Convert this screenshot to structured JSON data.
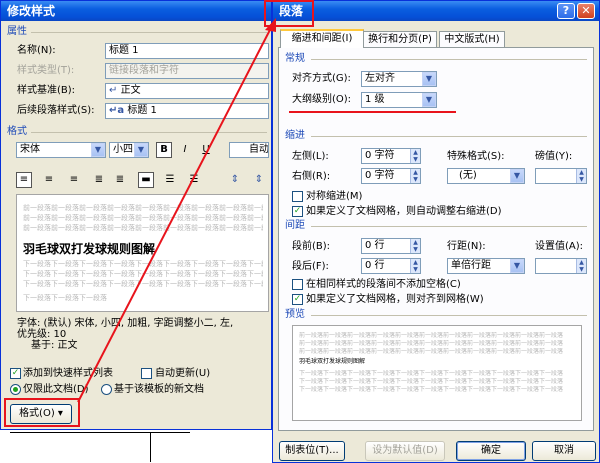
{
  "left_dialog": {
    "title": "修改样式",
    "properties_section": "属性",
    "name_label": "名称(N):",
    "name_value": "标题 1",
    "style_type_label": "样式类型(T):",
    "style_type_value": "链接段落和字符",
    "based_on_label": "样式基准(B):",
    "based_on_value": "正文",
    "following_label": "后续段落样式(S):",
    "following_value": "标题 1",
    "format_section": "格式",
    "font_value": "宋体",
    "size_value": "小四",
    "bold": "B",
    "italic": "I",
    "underline": "U",
    "auto_color": "自动",
    "preview": {
      "prev_text": "前一段落前一段落前一段落前一段落前一段落前一段落前一段落前一段落前一段落前一段落前一段落前一段落前一段落前一段落",
      "sample": "羽毛球双打发球规则图解",
      "next_text": "下一段落下一段落下一段落下一段落下一段落下一段落下一段落下一段落下一段落下一段落下一段落下一段落下一段落下一段落",
      "last_text": "下一段落下一段落下一段落"
    },
    "description_line1": "字体: (默认) 宋体, 小四, 加粗, 字距调整小二, 左,",
    "description_line2": "优先级: 10",
    "description_line3": "基于: 正文",
    "add_quick_label": "添加到快速样式列表",
    "auto_update_label": "自动更新(U)",
    "only_this_doc": "仅限此文档(D)",
    "template_docs": "基于该模板的新文档",
    "format_button": "格式(O) ▾"
  },
  "right_dialog": {
    "title": "段落",
    "help": "?",
    "close": "✕",
    "tabs": [
      "缩进和间距(I)",
      "换行和分页(P)",
      "中文版式(H)"
    ],
    "general_section": "常规",
    "alignment_label": "对齐方式(G):",
    "alignment_value": "左对齐",
    "outline_label": "大纲级别(O):",
    "outline_value": "1 级",
    "indent_section": "缩进",
    "left_label": "左侧(L):",
    "left_value": "0 字符",
    "right_label": "右侧(R):",
    "right_value": "0 字符",
    "special_label": "特殊格式(S):",
    "special_value": "(无)",
    "by_label": "磅值(Y):",
    "by_value": "",
    "mirror_label": "对称缩进(M)",
    "auto_right_label": "如果定义了文档网格，则自动调整右缩进(D)",
    "spacing_section": "间距",
    "before_label": "段前(B):",
    "before_value": "0 行",
    "after_label": "段后(F):",
    "after_value": "0 行",
    "line_spacing_label": "行距(N):",
    "line_spacing_value": "单倍行距",
    "at_label": "设置值(A):",
    "at_value": "",
    "no_space_label": "在相同样式的段落间不添加空格(C)",
    "snap_grid_label": "如果定义了文档网格，则对齐到网格(W)",
    "preview_section": "预览",
    "preview_prev": "前一段落前一段落前一段落前一段落前一段落前一段落前一段落前一段落前一段落前一段落前一段落",
    "preview_sample": "羽毛球双打发球规则图解",
    "preview_next": "下一段落下一段落下一段落下一段落下一段落下一段落下一段落下一段落下一段落下一段落下一段落",
    "tabs_button": "制表位(T)...",
    "default_button": "设为默认值(D)",
    "ok_button": "确定",
    "cancel_button": "取消"
  },
  "colors": {
    "annotation": "#e8141c",
    "titlebar": "#0a5ee0",
    "section": "#1f4bb8"
  }
}
